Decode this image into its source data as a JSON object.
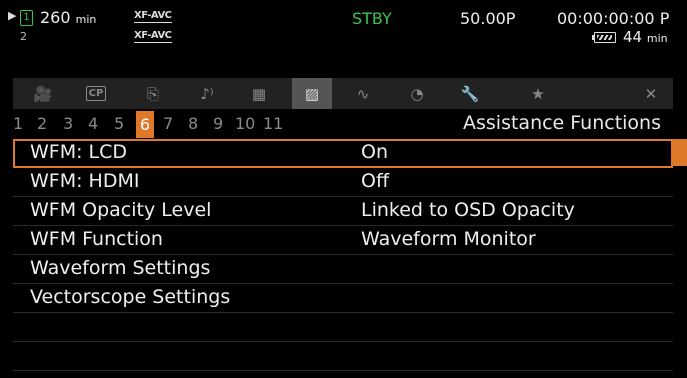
{
  "status": {
    "media_arrow": "▶",
    "card_slot": "1",
    "card2_slot": "2",
    "remaining": "260",
    "remaining_unit": "min",
    "format_top": "XF-AVC",
    "format_bottom": "XF-AVC",
    "mode": "STBY",
    "frame_rate": "50.00P",
    "timecode": "00:00:00:00",
    "timecode_suffix": "P",
    "battery_value": "44",
    "battery_unit": "min"
  },
  "tabs": [
    {
      "name": "camera-tab",
      "icon": "🎥"
    },
    {
      "name": "cp-tab",
      "label": "CP"
    },
    {
      "name": "recording-tab",
      "icon": "⎘"
    },
    {
      "name": "audio-tab",
      "icon": "♪⁾"
    },
    {
      "name": "video-setup-tab",
      "icon": "▦"
    },
    {
      "name": "assistance-tab",
      "icon": "▨"
    },
    {
      "name": "playback-tab",
      "icon": "∿"
    },
    {
      "name": "tc-tab",
      "icon": "◔"
    },
    {
      "name": "system-tab",
      "icon": "🔧"
    },
    {
      "name": "my-menu-tab",
      "icon": "★"
    },
    {
      "name": "close-tab",
      "icon": "✕"
    }
  ],
  "active_tab_index": 5,
  "pages": [
    "1",
    "2",
    "3",
    "4",
    "5",
    "6",
    "7",
    "8",
    "9",
    "10",
    "11"
  ],
  "active_page": "6",
  "page_title": "Assistance Functions",
  "menu_items": [
    {
      "label": "WFM: LCD",
      "value": "On"
    },
    {
      "label": "WFM: HDMI",
      "value": "Off"
    },
    {
      "label": "WFM Opacity Level",
      "value": "Linked to OSD Opacity"
    },
    {
      "label": "WFM Function",
      "value": "Waveform Monitor"
    },
    {
      "label": "Waveform Settings",
      "value": ""
    },
    {
      "label": "Vectorscope Settings",
      "value": ""
    },
    {
      "label": "",
      "value": ""
    },
    {
      "label": "",
      "value": ""
    }
  ],
  "selected_index": 0,
  "colors": {
    "accent": "#e0782a",
    "standby": "#39c64b"
  }
}
